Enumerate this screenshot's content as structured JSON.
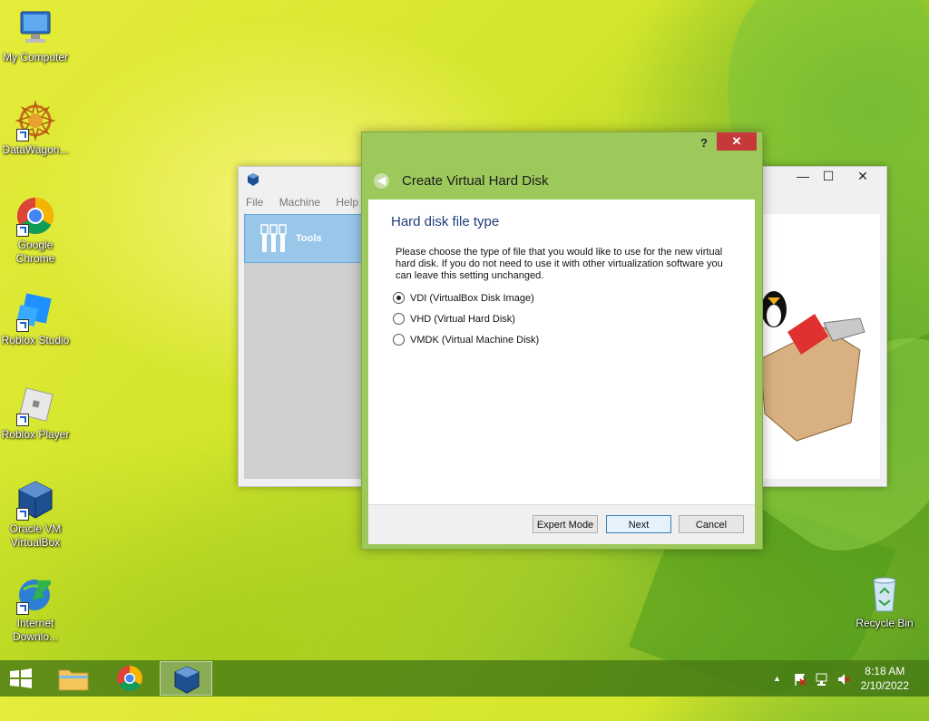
{
  "desktop": {
    "icons": [
      {
        "label": "My Computer"
      },
      {
        "label": "DataWagon..."
      },
      {
        "label": "Google Chrome"
      },
      {
        "label": "Roblox Studio"
      },
      {
        "label": "Roblox Player"
      },
      {
        "label": "Oracle VM VirtualBox"
      },
      {
        "label": "Internet Downlo..."
      },
      {
        "label": "Recycle Bin"
      }
    ]
  },
  "vbox_manager": {
    "menu": [
      "File",
      "Machine",
      "Help"
    ],
    "tools_label": "Tools",
    "window_buttons": {
      "minimize": "—",
      "maximize": "☐",
      "close": "✕"
    }
  },
  "dialog": {
    "help": "?",
    "close": "✕",
    "back": "◀",
    "title": "Create Virtual Hard Disk",
    "section_title": "Hard disk file type",
    "description": "Please choose the type of file that you would like to use for the new virtual hard disk. If you do not need to use it with other virtualization software you can leave this setting unchanged.",
    "options": [
      {
        "label": "VDI (VirtualBox Disk Image)",
        "selected": true
      },
      {
        "label": "VHD (Virtual Hard Disk)",
        "selected": false
      },
      {
        "label": "VMDK (Virtual Machine Disk)",
        "selected": false
      }
    ],
    "buttons": {
      "expert": "Expert Mode",
      "next": "Next",
      "cancel": "Cancel"
    }
  },
  "taskbar": {
    "time": "8:18 AM",
    "date": "2/10/2022",
    "tray_expand": "▲"
  },
  "colors": {
    "dialog_frame": "#9dc95c",
    "close_red": "#c7383a",
    "section_title": "#1f3d7a"
  }
}
